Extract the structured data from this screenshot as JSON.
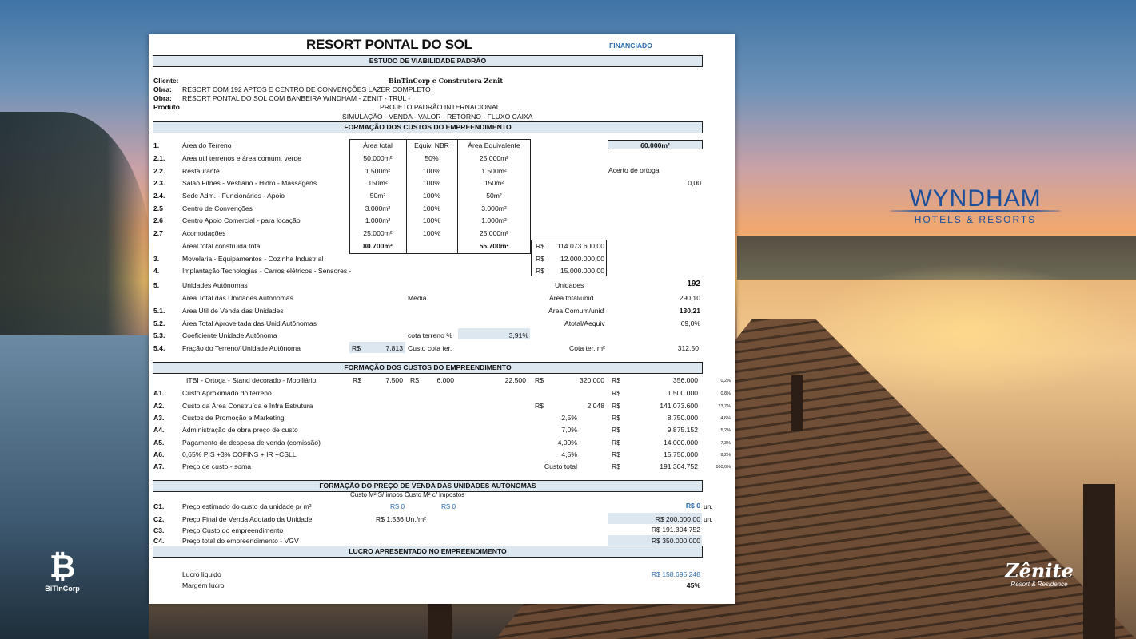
{
  "logos": {
    "wyndham_name": "WYNDHAM",
    "wyndham_sub": "HOTELS & RESORTS",
    "bitincorp_name": "BiTInCorp",
    "zenite_name": "Zênite",
    "zenite_sub": "Resort & Residence"
  },
  "header": {
    "title": "RESORT PONTAL DO SOL",
    "tag": "FINANCIADO",
    "band": "ESTUDO DE VIABILIDADE  PADRÃO"
  },
  "info": {
    "cliente_label": "Cliente:",
    "cliente_value": "BinTinCorp e Construtora Zenit",
    "obra1_label": "Obra:",
    "obra1_value": "RESORT COM 192 APTOS E CENTRO DE CONVENÇÕES LAZER COMPLETO",
    "obra2_label": "Obra:",
    "obra2_value": "RESORT PONTAL DO SOL COM BANBEIRA WINDHAM - ZENIT - TRUL -",
    "produto_label": "Produto",
    "produto_value": "PROJETO PADRÃO INTERNACIONAL",
    "simulacao": "SIMULAÇÃO  - VENDA - VALOR - RETORNO - FLUXO CAIXA"
  },
  "sec1": {
    "band": "FORMAÇÃO DOS CUSTOS DO EMPREENDIMENTO",
    "col_area": "Área total",
    "col_equiv": "Equiv. NBR",
    "col_areaeq": "Área Equivalente",
    "terreno_total": "60.000m²",
    "acerto_label": "Acerto de ortoga",
    "acerto_value": "0,00",
    "rows": [
      {
        "n": "1.",
        "label": "Área do Terreno",
        "area": "",
        "eq": "",
        "aeq": ""
      },
      {
        "n": "2.1.",
        "label": "Area util terrenos e área comum, verde",
        "area": "50.000m²",
        "eq": "50%",
        "aeq": "25.000m²"
      },
      {
        "n": "2.2.",
        "label": "Restaurante",
        "area": "1.500m²",
        "eq": "100%",
        "aeq": "1.500m²"
      },
      {
        "n": "2.3.",
        "label": "Salão Fitnes - Vestiário - Hidro - Massagens",
        "area": "150m²",
        "eq": "100%",
        "aeq": "150m²"
      },
      {
        "n": "2.4.",
        "label": "Sede Adm. - Funcionários - Apoio",
        "area": "50m²",
        "eq": "100%",
        "aeq": "50m²"
      },
      {
        "n": "2.5",
        "label": "Centro de Convenções",
        "area": "3.000m²",
        "eq": "100%",
        "aeq": "3.000m²"
      },
      {
        "n": "2.6",
        "label": "Centro Apoio Comercial - para locação",
        "area": "1.000m²",
        "eq": "100%",
        "aeq": "1.000m²"
      },
      {
        "n": "2.7",
        "label": "Acomodações",
        "area": "25.000m²",
        "eq": "100%",
        "aeq": "25.000m²"
      }
    ],
    "areal_label": "Áreal total construida total",
    "areal_total": "80.700m²",
    "areal_eq": "55.700m²",
    "areal_rs": "R$",
    "areal_value": "114.073.600,00",
    "r3_n": "3.",
    "r3_label": "Movelaria - Equipamentos - Cozinha Industrial",
    "r3_rs": "R$",
    "r3_value": "12.000.000,00",
    "r4_n": "4.",
    "r4_label": "Implantação Tecnologias - Carros elétricos - Sensores -",
    "r4_rs": "R$",
    "r4_value": "15.000.000,00",
    "r5_n": "5.",
    "r5_label": "Unidades Autônomas",
    "r5_k": "Unidades",
    "r5_v": "192",
    "r5b_label": "Area Total das Unidades Autonomas",
    "r5b_mid": "Média",
    "r5b_k": "Área total/unid",
    "r5b_v": "290,10",
    "r51_n": "5.1.",
    "r51_label": "Área Útil de Venda das Unidades",
    "r51_k": "Área Comum/unid",
    "r51_v": "130,21",
    "r52_n": "5.2.",
    "r52_label": "Área Total Aproveitada das Unid Autônomas",
    "r52_k": "Atotal/Aequiv",
    "r52_v": "69,0%",
    "r53_n": "5.3.",
    "r53_label": "Coeficiente Unidade Autônoma",
    "r53_k": "cota terreno %",
    "r53_v": "3,91%",
    "r54_n": "5.4.",
    "r54_label": "Fração do Terreno/ Unidade Autônoma",
    "r54_rs": "R$",
    "r54_v": "7.813",
    "r54_k": "Custo cota ter.",
    "r54_k2": "Cota ter. m²",
    "r54_v2": "312,50"
  },
  "sec2": {
    "band": "FORMAÇÃO DOS CUSTOS DO EMPREENDIMENTO",
    "itbi_label": "ITBI   -  Ortoga   -   Stand decorado - Mobiliário",
    "itbi_rs1": "R$",
    "itbi_v1": "7.500",
    "itbi_rs2": "R$",
    "itbi_v2": "6.000",
    "itbi_v3": "22.500",
    "itbi_rs4": "R$",
    "itbi_v4": "320.000",
    "itbi_rs5": "R$",
    "itbi_v5": "356.000",
    "itbi_pct": "0,2%",
    "rows": [
      {
        "n": "A1.",
        "label": "Custo Aproximado do terreno",
        "rs0": "",
        "mid": "",
        "pct": "",
        "rs": "R$",
        "v": "1.500.000",
        "sp": "0,8%"
      },
      {
        "n": "A2.",
        "label": "Custo da Área Construída e Infra Estrutura",
        "rs0": "R$",
        "mid": "2.048",
        "pct": "",
        "rs": "R$",
        "v": "141.073.600",
        "sp": "73,7%"
      },
      {
        "n": "A3.",
        "label": "Custos de Promoção e Marketing",
        "rs0": "",
        "mid": "",
        "pct": "2,5%",
        "rs": "R$",
        "v": "8.750.000",
        "sp": "4,6%"
      },
      {
        "n": "A4.",
        "label": "Administração de obra preço de custo",
        "rs0": "",
        "mid": "",
        "pct": "7,0%",
        "rs": "R$",
        "v": "9.875.152",
        "sp": "5,2%"
      },
      {
        "n": "A5.",
        "label": "Pagamento de despesa de venda (comissão)",
        "rs0": "",
        "mid": "",
        "pct": "4,00%",
        "rs": "R$",
        "v": "14.000.000",
        "sp": "7,3%"
      },
      {
        "n": "A6.",
        "label": "0,65% PIS +3% COFINS + IR +CSLL",
        "rs0": "",
        "mid": "",
        "pct": "4,5%",
        "rs": "R$",
        "v": "15.750.000",
        "sp": "8,2%"
      },
      {
        "n": "A7.",
        "label": "Preço de custo - soma",
        "rs0": "",
        "mid": "",
        "pct": "Custo total",
        "rs": "R$",
        "v": "191.304.752",
        "sp": "100,0%"
      }
    ]
  },
  "sec3": {
    "band": "FORMAÇÃO DO PREÇO DE VENDA DAS UNIDADES AUTONOMAS",
    "sub": "Custo M² S/ impos Custo M² c/ impostos",
    "c1_n": "C1.",
    "c1_label": "Preço estimado do custo da unidade p/ m²",
    "c1_a": "R$ 0",
    "c1_b": "R$ 0",
    "c1_v": "R$ 0",
    "c1_unit": "un.",
    "c2_n": "C2.",
    "c2_label": "Preço Final de Venda Adotado da Unidade",
    "c2_mid": "R$ 1.536 Un./m²",
    "c2_v": "R$ 200.000,00",
    "c2_unit": "un.",
    "c3_n": "C3.",
    "c3_label": "Preço  Custo  do empreendimento",
    "c3_v": "R$ 191.304.752",
    "c4_n": "C4.",
    "c4_label": "Preço total do empreendimento     -  VGV",
    "c4_v": "R$ 350.000.000"
  },
  "sec4": {
    "band": "LUCRO APRESENTADO NO EMPREENDIMENTO",
    "lucro_label": "Lucro liquido",
    "lucro_v": "R$ 158.695.248",
    "margem_label": "Margem lucro",
    "margem_v": "45%"
  }
}
